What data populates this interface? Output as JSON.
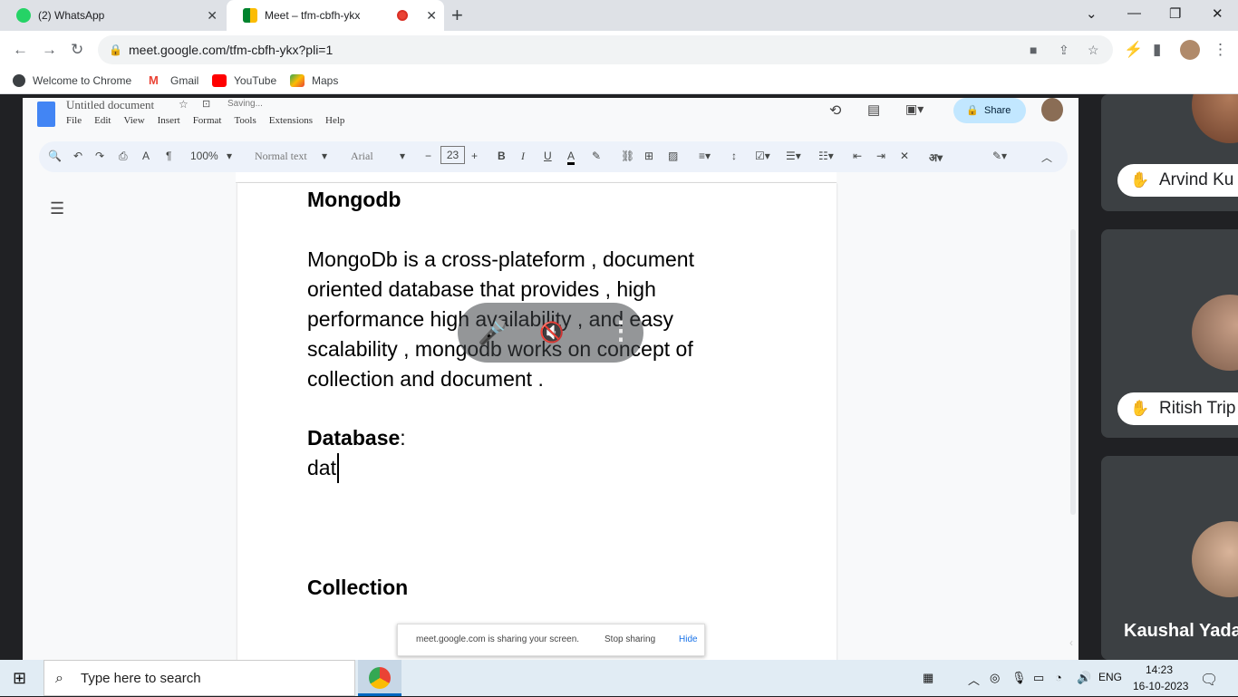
{
  "browser": {
    "tabs": [
      {
        "title": "(2) WhatsApp",
        "icon": "whatsapp-icon"
      },
      {
        "title": "Meet – tfm-cbfh-ykx",
        "icon": "google-meet-icon",
        "recording": true
      }
    ],
    "url": "meet.google.com/tfm-cbfh-ykx?pli=1",
    "bookmarks": [
      "Welcome to Chrome",
      "Gmail",
      "YouTube",
      "Maps"
    ]
  },
  "docs": {
    "title": "Untitled document",
    "status": "Saving...",
    "menu": [
      "File",
      "Edit",
      "View",
      "Insert",
      "Format",
      "Tools",
      "Extensions",
      "Help"
    ],
    "share_label": "Share",
    "zoom": "100%",
    "style": "Normal text",
    "font": "Arial",
    "font_size": "23"
  },
  "document": {
    "heading1": "Mongodb",
    "para": [
      "MongoDb is a cross-plateform , document",
      "oriented database that provides , high",
      "performance high availability , and easy",
      "scalability , mongodb works on concept of",
      "collection and document ."
    ],
    "heading2": "Database",
    "heading2_suffix": ":",
    "typing": "dat",
    "heading3": "Collection"
  },
  "share_notice": {
    "text": "meet.google.com is sharing your screen.",
    "stop": "Stop sharing",
    "hide": "Hide"
  },
  "participants": [
    {
      "name": "Arvind Ku"
    },
    {
      "name": "Ritish Trip"
    },
    {
      "name": "Kaushal Yada"
    }
  ],
  "taskbar": {
    "search_placeholder": "Type here to search",
    "lang": "ENG",
    "time": "14:23",
    "date": "16-10-2023"
  }
}
